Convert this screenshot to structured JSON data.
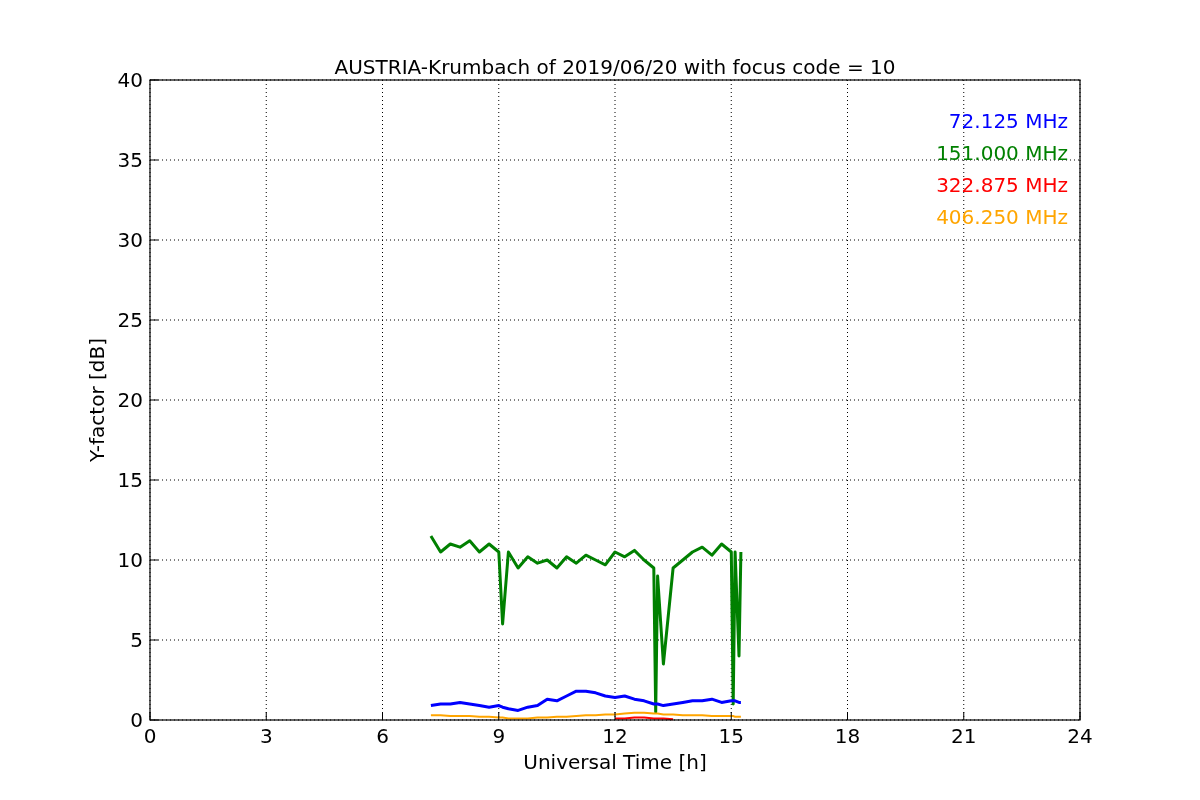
{
  "chart_data": {
    "type": "line",
    "title": "AUSTRIA-Krumbach of 2019/06/20 with focus code = 10",
    "xlabel": "Universal Time [h]",
    "ylabel": "Y-factor [dB]",
    "x": [
      7.25,
      7.5,
      7.75,
      8,
      8.25,
      8.5,
      8.75,
      9,
      9.1,
      9.25,
      9.5,
      9.75,
      10,
      10.25,
      10.5,
      10.75,
      11,
      11.25,
      11.5,
      11.75,
      12,
      12.25,
      12.5,
      12.75,
      13,
      13.05,
      13.1,
      13.25,
      13.5,
      13.75,
      14,
      14.25,
      14.5,
      14.75,
      15,
      15.05,
      15.1,
      15.2,
      15.25
    ],
    "series": [
      {
        "name": "72.125 MHz",
        "color": "#0000ff",
        "values": [
          0.9,
          1,
          1,
          1.1,
          1,
          0.9,
          0.8,
          0.9,
          0.8,
          0.7,
          0.6,
          0.8,
          0.9,
          1.3,
          1.2,
          1.5,
          1.8,
          1.8,
          1.7,
          1.5,
          1.4,
          1.5,
          1.3,
          1.2,
          1,
          1,
          1,
          0.9,
          1,
          1.1,
          1.2,
          1.2,
          1.3,
          1.1,
          1.2,
          1.2,
          1.2,
          1.1,
          1.1
        ]
      },
      {
        "name": "151.000 MHz",
        "color": "#008000",
        "values": [
          11.5,
          10.5,
          11,
          10.8,
          11.2,
          10.5,
          11,
          10.5,
          6,
          10.5,
          9.5,
          10.2,
          9.8,
          10,
          9.5,
          10.2,
          9.8,
          10.3,
          10,
          9.7,
          10.5,
          10.2,
          10.6,
          10,
          9.5,
          0.5,
          9,
          3.5,
          9.5,
          10,
          10.5,
          10.8,
          10.3,
          11,
          10.5,
          1,
          10.5,
          4,
          10.5
        ]
      },
      {
        "name": "322.875 MHz",
        "color": "#ff0000",
        "values": [
          null,
          null,
          null,
          null,
          null,
          null,
          null,
          null,
          null,
          null,
          null,
          null,
          null,
          null,
          null,
          null,
          null,
          null,
          null,
          null,
          0.1,
          0.1,
          0.15,
          0.15,
          0.1,
          0.1,
          0.1,
          0.1,
          0.05,
          null,
          null,
          null,
          null,
          null,
          null,
          null,
          null,
          null,
          null
        ]
      },
      {
        "name": "406.250 MHz",
        "color": "#ffa500",
        "values": [
          0.3,
          0.3,
          0.25,
          0.25,
          0.25,
          0.2,
          0.2,
          0.15,
          0.15,
          0.1,
          0.1,
          0.1,
          0.15,
          0.15,
          0.2,
          0.2,
          0.25,
          0.3,
          0.3,
          0.35,
          0.35,
          0.4,
          0.45,
          0.45,
          0.4,
          0.4,
          0.4,
          0.35,
          0.35,
          0.3,
          0.3,
          0.3,
          0.25,
          0.25,
          0.25,
          0.25,
          0.2,
          0.2,
          0.2
        ]
      }
    ],
    "grid": true,
    "xlim": [
      0,
      24
    ],
    "ylim": [
      0,
      40
    ],
    "xticks": [
      0,
      3,
      6,
      9,
      12,
      15,
      18,
      21,
      24
    ],
    "yticks": [
      0,
      5,
      10,
      15,
      20,
      25,
      30,
      35,
      40
    ]
  }
}
